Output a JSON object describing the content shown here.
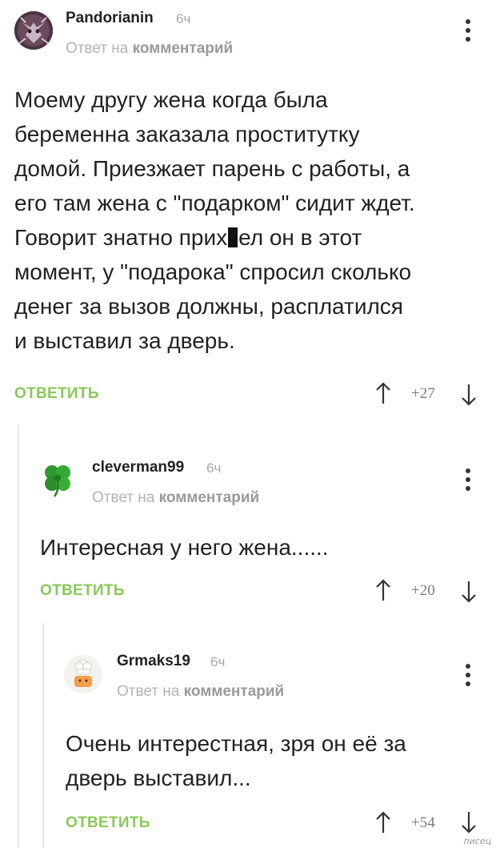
{
  "comments": [
    {
      "username": "Pandorianin",
      "time": "6ч",
      "reply_prefix": "Ответ на",
      "reply_target": "комментарий",
      "lines": [
        "Моему другу жена когда была",
        "беременна заказала проститутку",
        "домой. Приезжает парень с работы, а",
        "его там жена с \"подарком\" сидит ждет.",
        "Говорит знатно прих",
        "ел он в этот",
        "момент,  у \"подарока\" спросил сколько",
        "денег за вызов должны, расплатился",
        "и выставил за дверь."
      ],
      "reply_label": "ОТВЕТИТЬ",
      "rating": "+27"
    },
    {
      "username": "cleverman99",
      "time": "6ч",
      "reply_prefix": "Ответ на",
      "reply_target": "комментарий",
      "lines": [
        "Интересная у него жена......"
      ],
      "reply_label": "ОТВЕТИТЬ",
      "rating": "+20"
    },
    {
      "username": "Grmaks19",
      "time": "6ч",
      "reply_prefix": "Ответ на",
      "reply_target": "комментарий",
      "lines": [
        "Очень интерестная, зря он её за",
        "дверь выставил..."
      ],
      "reply_label": "ОТВЕТИТЬ",
      "rating": "+54"
    }
  ],
  "watermark": "писец",
  "colors": {
    "accent_reply": "#8ac858",
    "thread_line": "#e6e6e6",
    "meta_gray": "#b4b4b4"
  },
  "icons": [
    "avatar-pandorianin",
    "clover-avatar-icon",
    "chef-avatar-icon",
    "more-vertical-icon",
    "arrow-up-icon",
    "arrow-down-icon"
  ]
}
